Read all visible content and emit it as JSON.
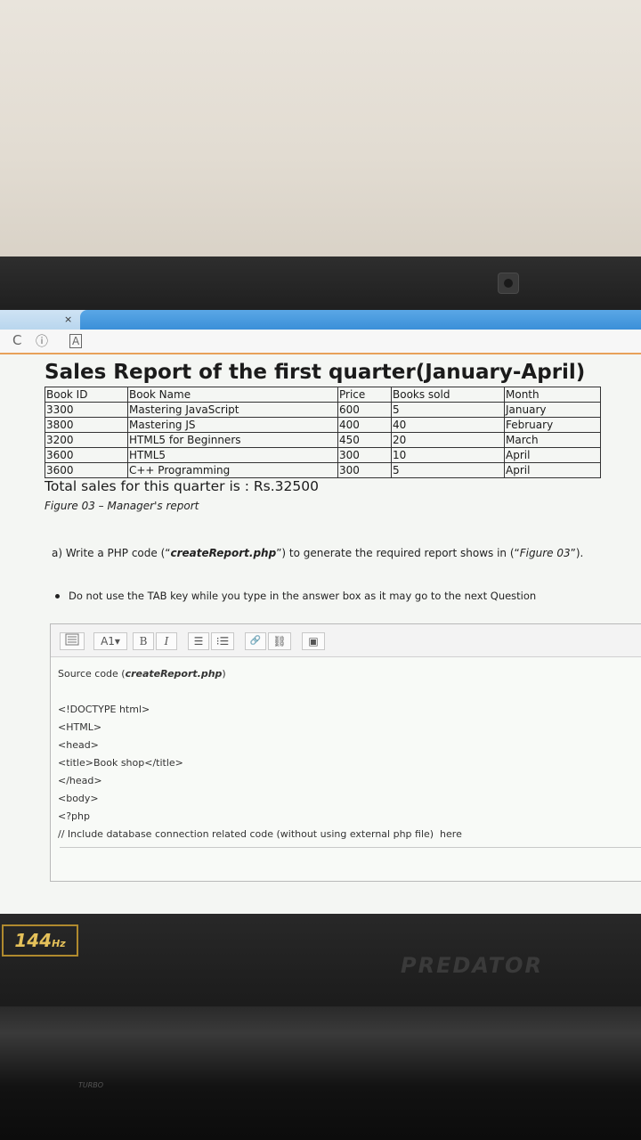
{
  "browser": {
    "tab_close": "×",
    "reload_icon": "C",
    "info_icon": "ⓘ",
    "reader_icon": "A"
  },
  "report": {
    "title": "Sales Report of the first quarter(January-April)",
    "headers": [
      "Book ID",
      "Book Name",
      "Price",
      "Books sold",
      "Month"
    ],
    "rows": [
      [
        "3300",
        "Mastering JavaScript",
        "600",
        "5",
        "January"
      ],
      [
        "3800",
        "Mastering JS",
        "400",
        "40",
        "February"
      ],
      [
        "3200",
        "HTML5 for Beginners",
        "450",
        "20",
        "March"
      ],
      [
        "3600",
        "HTML5",
        "300",
        "10",
        "April"
      ],
      [
        "3600",
        "C++ Programming",
        "300",
        "5",
        "April"
      ]
    ],
    "total": "Total sales for this quarter is : Rs.32500",
    "caption": "Figure 03 – Manager's report"
  },
  "question": {
    "prefix": "a)  Write a PHP code (“",
    "filename": "createReport.php",
    "middle": "”) to generate the required report shows in (“",
    "figure": "Figure 03",
    "suffix": "”)."
  },
  "instruction": "Do not use the TAB key while you type in the answer box as it may go to the next Question",
  "toolbar": {
    "font_size": "A1▾",
    "bold": "B",
    "italic": "I",
    "bullet_list": "☰",
    "numbered_list": "⁝☰",
    "link": "🔗",
    "unlink": "⛓",
    "image": "▣"
  },
  "answer": {
    "src_label": "Source code (",
    "src_file": "createReport.php",
    "src_end": ")",
    "lines": [
      "<!DOCTYPE html>",
      "<HTML>",
      "<head>",
      "<title>Book shop</title>",
      "</head>",
      "<body>",
      "<?php",
      "// Include database connection related code (without using external php file)  here"
    ]
  },
  "monitor": {
    "refresh_badge": "144",
    "refresh_unit": "Hz",
    "brand": "PREDATOR",
    "turbo": "TURBO"
  }
}
